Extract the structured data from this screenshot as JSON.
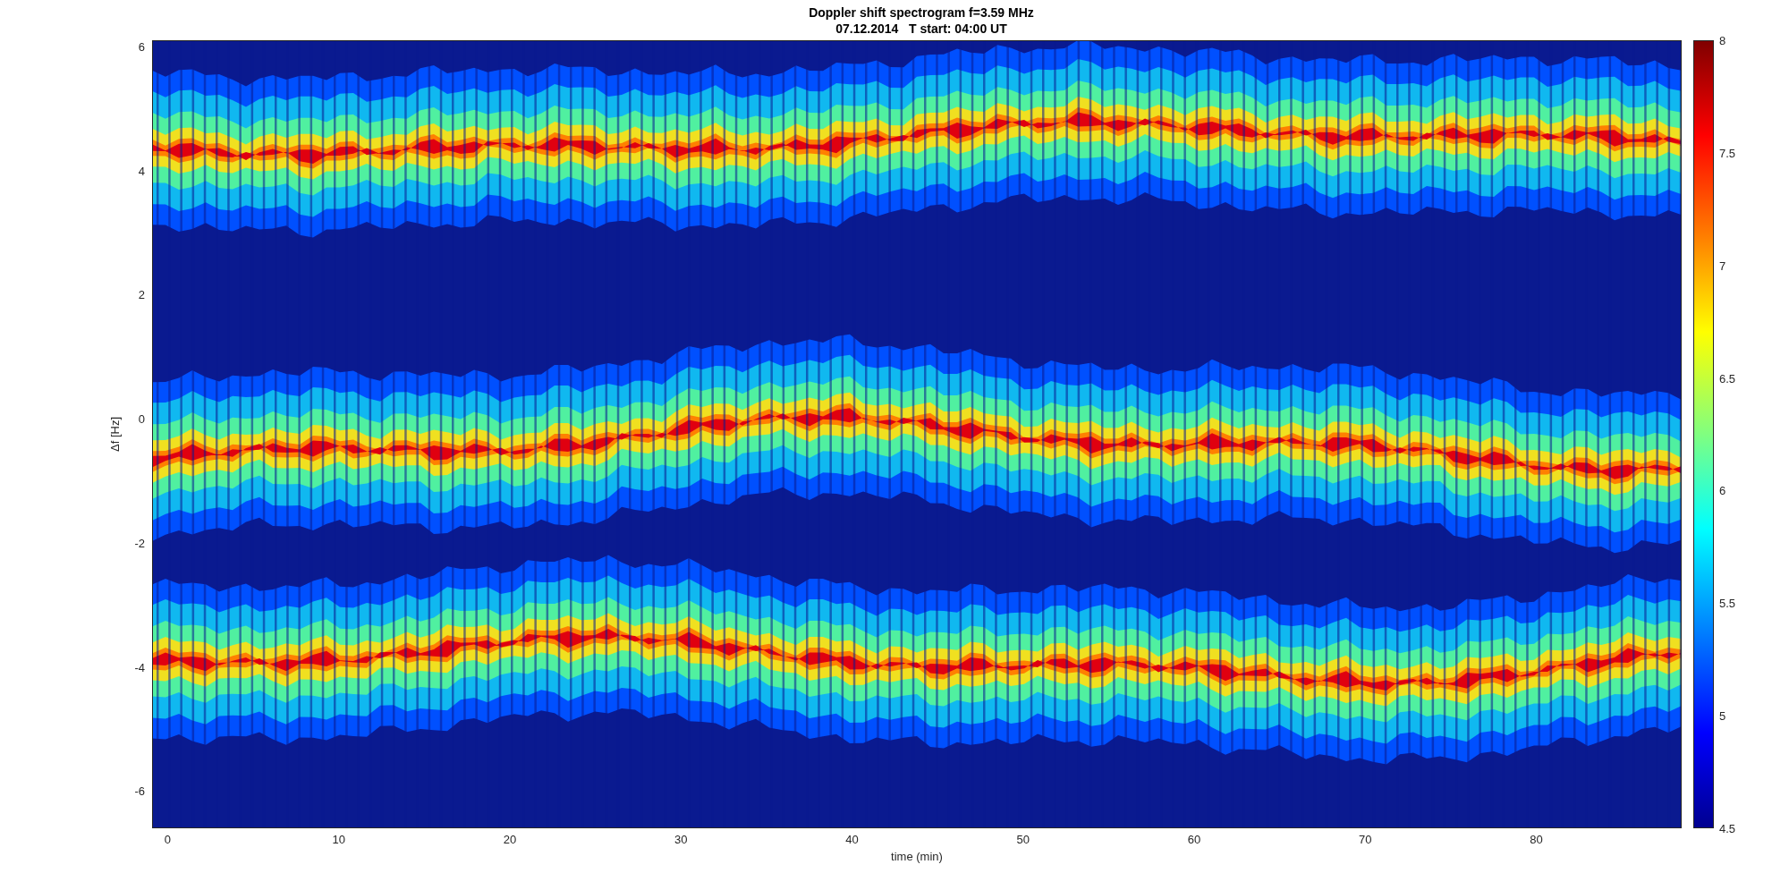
{
  "figure": {
    "title": "Doppler shift spectrogram f=3.59 MHz",
    "subtitle": "07.12.2014   T start: 04:00 UT",
    "xlabel": "time (min)",
    "ylabel": "Δf [Hz]",
    "xticks": [
      "0",
      "10",
      "20",
      "30",
      "40",
      "50",
      "60",
      "70",
      "80"
    ],
    "yticks": [
      "6",
      "4",
      "2",
      "0",
      "-2",
      "-4",
      "-6"
    ],
    "colorbar_ticks": [
      "8",
      "7.5",
      "7",
      "6.5",
      "6",
      "5.5",
      "5",
      "4.5"
    ]
  }
}
